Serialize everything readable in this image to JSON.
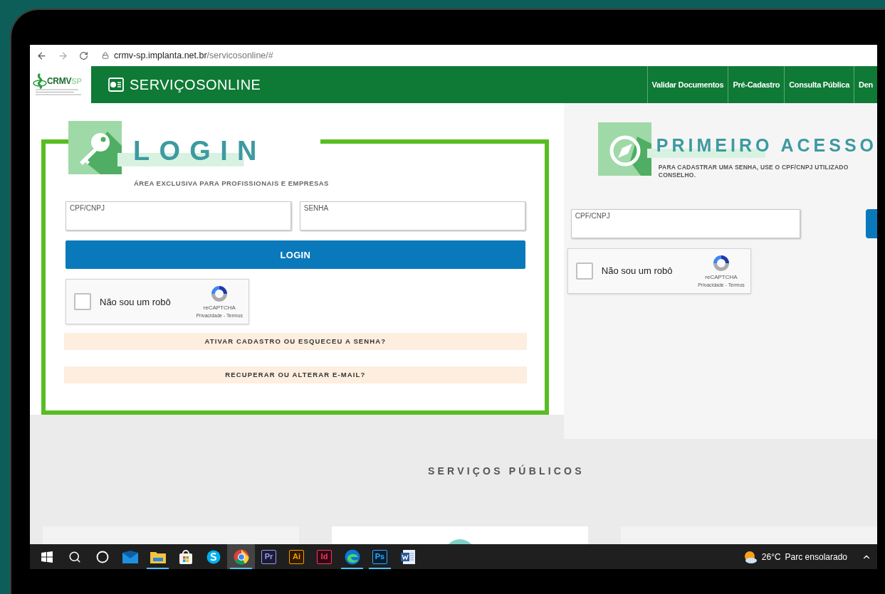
{
  "browser": {
    "url_host": "crmv-sp.implanta.net.br",
    "url_path": "/servicosonline/#"
  },
  "header": {
    "logo": {
      "main": "CRMV",
      "accent": "SP"
    },
    "title": "SERVIÇOSONLINE",
    "nav": [
      "Validar Documentos",
      "Pré-Cadastro",
      "Consulta Pública",
      "Den"
    ]
  },
  "login": {
    "title": "LOGIN",
    "subtitle": "ÁREA EXCLUSIVA PARA PROFISSIONAIS E EMPRESAS",
    "fields": [
      {
        "label": "CPF/CNPJ"
      },
      {
        "label": "SENHA"
      }
    ],
    "button": "LOGIN",
    "captcha": {
      "label": "Não sou um robô",
      "checked": false,
      "brand": "reCAPTCHA",
      "links": "Privacidade - Termos"
    },
    "links": [
      "ATIVAR CADASTRO OU ESQUECEU A SENHA?",
      "RECUPERAR OU ALTERAR E-MAIL?"
    ]
  },
  "first_access": {
    "title": "PRIMEIRO ACESSO",
    "text_lines": [
      "PARA CADASTRAR UMA SENHA, USE O CPF/CNPJ UTILIZADO",
      "CONSELHO."
    ],
    "field": {
      "label": "CPF/CNPJ"
    },
    "captcha": {
      "label": "Não sou um robô",
      "checked": false,
      "brand": "reCAPTCHA",
      "links": "Privacidade - Termos"
    }
  },
  "public_services": {
    "title": "SERVIÇOS PÚBLICOS"
  },
  "taskbar": {
    "apps": [
      {
        "kind": "windows",
        "running": false,
        "selected": false
      },
      {
        "kind": "search",
        "running": false,
        "selected": false
      },
      {
        "kind": "cortana",
        "running": false,
        "selected": false
      },
      {
        "kind": "mail",
        "running": false,
        "selected": false
      },
      {
        "kind": "explorer",
        "running": true,
        "selected": false
      },
      {
        "kind": "store",
        "running": false,
        "selected": false
      },
      {
        "kind": "skype",
        "running": false,
        "selected": false
      },
      {
        "kind": "chrome",
        "running": true,
        "selected": true
      },
      {
        "kind": "badge",
        "label": "Pr",
        "color": "#9999ff",
        "running": false,
        "selected": false
      },
      {
        "kind": "badge",
        "label": "Ai",
        "color": "#ff9a00",
        "running": false,
        "selected": false
      },
      {
        "kind": "badge",
        "label": "Id",
        "color": "#ff3366",
        "running": false,
        "selected": false
      },
      {
        "kind": "edge",
        "running": true,
        "selected": false
      },
      {
        "kind": "badge",
        "label": "Ps",
        "color": "#31a8ff",
        "running": true,
        "selected": false
      },
      {
        "kind": "word",
        "running": false,
        "selected": false
      }
    ],
    "weather": {
      "temperature": "26°C",
      "condition": "Parc ensolarado"
    }
  }
}
